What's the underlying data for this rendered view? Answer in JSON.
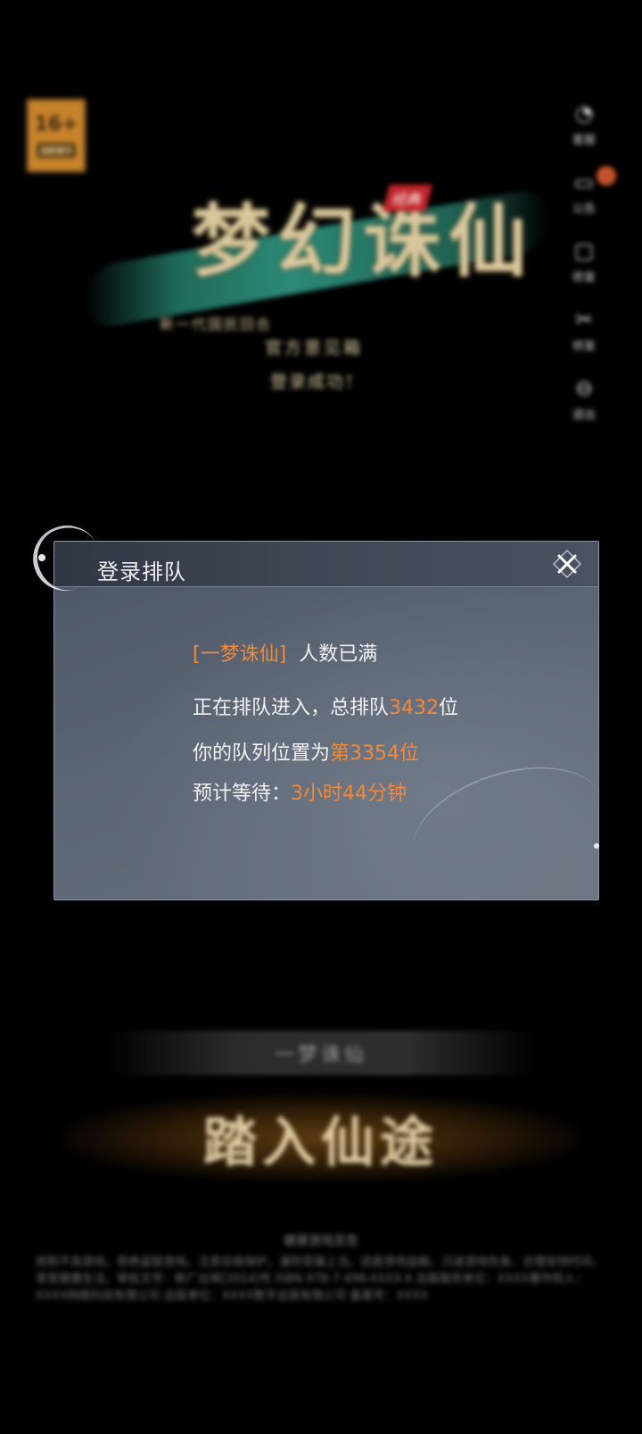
{
  "background": {
    "age_badge": {
      "rating": "16+",
      "label": "适龄提示"
    },
    "logo": {
      "title": "梦幻诛仙",
      "tag": "经典",
      "slogan": "新一代国民回合",
      "site": "官方意见箱",
      "login_hint": "登录成功！"
    },
    "side_menu": [
      {
        "icon": "headset-icon",
        "glyph": "◔",
        "label": "客服"
      },
      {
        "icon": "notice-icon",
        "glyph": "▭",
        "label": "公告"
      },
      {
        "icon": "mail-icon",
        "glyph": "▢",
        "label": "修复"
      },
      {
        "icon": "tools-icon",
        "glyph": "✂",
        "label": "修复"
      },
      {
        "icon": "exit-icon",
        "glyph": "⊖",
        "label": "退出"
      }
    ],
    "server_name": "一梦诛仙",
    "enter_button": "踏入仙途",
    "footer_title": "健康游戏忠告",
    "footer_text": "抵制不良游戏，拒绝盗版游戏。注意自我保护，谨防受骗上当。适度游戏益脑，沉迷游戏伤身。合理安排时间，享受健康生活。审批文号：新广出审[2014]号 ISBN 978-7-498-XXXX-X 出版服务单位：XXXX著作权人：XXXX网络科技有限公司 出版单位：XXXX数字出版有限公司 备案号：XXXX",
    "accent_color": "#c4532c"
  },
  "dialog": {
    "title": "登录排队",
    "server_bracket_open": "[",
    "server": "一梦诛仙",
    "server_bracket_close": "]",
    "full_text": "人数已满",
    "queue_prefix": "正在排队进入，总排队",
    "queue_total": "3432",
    "queue_suffix": "位",
    "position_prefix": "你的队列位置为",
    "position_value": "第3354位",
    "wait_prefix": "预计等待：",
    "wait_value": "3小时44分钟",
    "accent_color": "#f08a3a"
  }
}
